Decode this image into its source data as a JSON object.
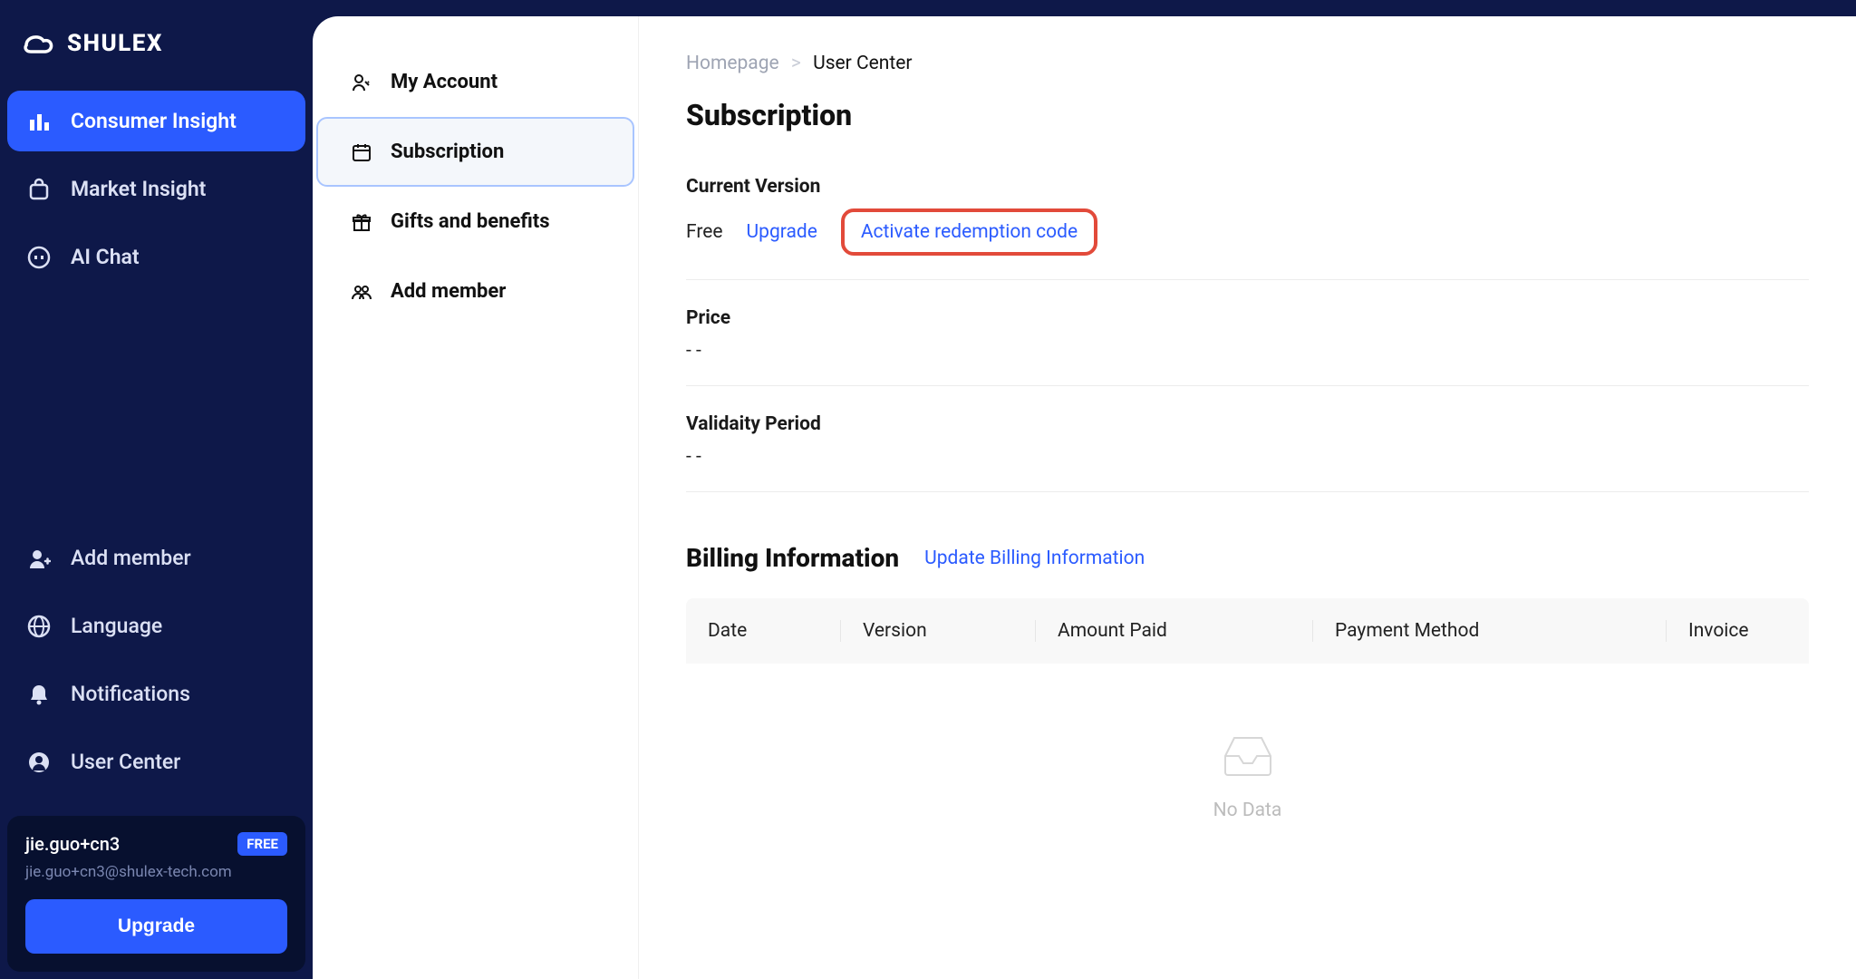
{
  "brand": {
    "name": "SHULEX"
  },
  "sidebar": {
    "items": [
      {
        "label": "Consumer Insight"
      },
      {
        "label": "Market Insight"
      },
      {
        "label": "AI Chat"
      }
    ],
    "bottom": [
      {
        "label": "Add member"
      },
      {
        "label": "Language"
      },
      {
        "label": "Notifications"
      },
      {
        "label": "User Center"
      }
    ]
  },
  "userCard": {
    "name": "jie.guo+cn3",
    "badge": "FREE",
    "email": "jie.guo+cn3@shulex-tech.com",
    "upgrade": "Upgrade"
  },
  "subnav": {
    "items": [
      {
        "label": "My Account"
      },
      {
        "label": "Subscription"
      },
      {
        "label": "Gifts and benefits"
      },
      {
        "label": "Add member"
      }
    ]
  },
  "breadcrumb": {
    "home": "Homepage",
    "sep": ">",
    "current": "User Center"
  },
  "page": {
    "title": "Subscription",
    "currentVersionLabel": "Current Version",
    "currentVersionValue": "Free",
    "upgradeLink": "Upgrade",
    "activateLink": "Activate redemption code",
    "priceLabel": "Price",
    "priceValue": "- -",
    "validityLabel": "Validaity Period",
    "validityValue": "- -",
    "billingTitle": "Billing Information",
    "updateBilling": "Update Billing Information",
    "table": {
      "headers": {
        "date": "Date",
        "version": "Version",
        "amount": "Amount Paid",
        "payment": "Payment Method",
        "invoice": "Invoice"
      },
      "empty": "No Data"
    }
  }
}
